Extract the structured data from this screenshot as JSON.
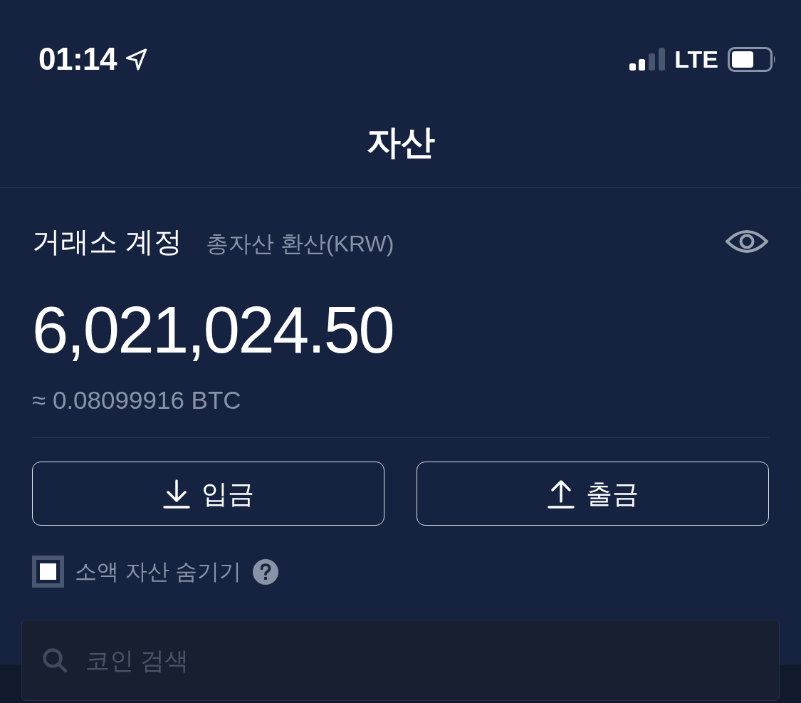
{
  "status_bar": {
    "time": "01:14",
    "network": "LTE"
  },
  "header": {
    "title": "자산"
  },
  "account": {
    "title": "거래소 계정",
    "subtitle": "총자산 환산(KRW)",
    "total": "6,021,024.50",
    "btc_equivalent": "≈ 0.08099916 BTC"
  },
  "actions": [
    {
      "kind": "deposit",
      "label": "입금"
    },
    {
      "kind": "withdraw",
      "label": "출금"
    }
  ],
  "hide_small_balances": {
    "label": "소액 자산 숨기기",
    "checked": true
  },
  "search": {
    "placeholder": "코인 검색"
  }
}
